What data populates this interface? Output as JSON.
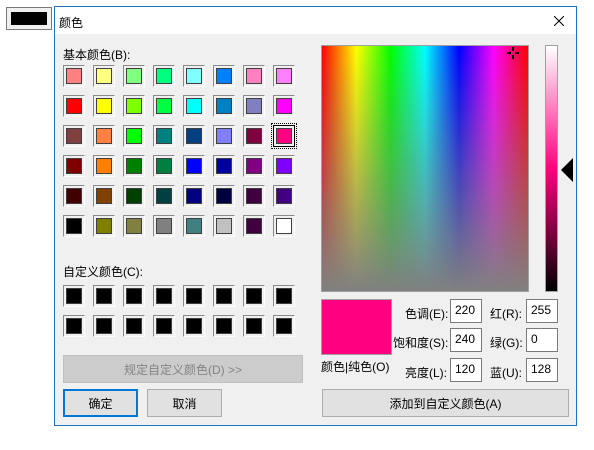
{
  "title": "颜色",
  "labels": {
    "basic_colors": "基本颜色(B):",
    "custom_colors": "自定义颜色(C):",
    "color_solid": "颜色|纯色(O)",
    "hue": "色调(E):",
    "sat": "饱和度(S):",
    "lum": "亮度(L):",
    "red": "红(R):",
    "green": "绿(G):",
    "blue": "蓝(U):"
  },
  "buttons": {
    "define_custom": "规定自定义颜色(D) >>",
    "ok": "确定",
    "cancel": "取消",
    "add_custom": "添加到自定义颜色(A)"
  },
  "values": {
    "hue": "220",
    "sat": "240",
    "lum": "120",
    "red": "255",
    "green": "0",
    "blue": "128"
  },
  "colors": {
    "selected": "#ff0080",
    "accent": "#0078d7"
  },
  "basic_colors": [
    "#ff8080",
    "#ffff80",
    "#80ff80",
    "#00ff80",
    "#80ffff",
    "#0080ff",
    "#ff80c0",
    "#ff80ff",
    "#ff0000",
    "#ffff00",
    "#80ff00",
    "#00ff40",
    "#00ffff",
    "#0080c0",
    "#8080c0",
    "#ff00ff",
    "#804040",
    "#ff8040",
    "#00ff00",
    "#008080",
    "#004080",
    "#8080ff",
    "#800040",
    "#ff0080",
    "#800000",
    "#ff8000",
    "#008000",
    "#008040",
    "#0000ff",
    "#0000a0",
    "#800080",
    "#8000ff",
    "#400000",
    "#804000",
    "#004000",
    "#004040",
    "#000080",
    "#000040",
    "#400040",
    "#400080",
    "#000000",
    "#808000",
    "#808040",
    "#808080",
    "#408080",
    "#c0c0c0",
    "#400040",
    "#ffffff"
  ],
  "selected_index": 23,
  "custom_colors": [
    "#000000",
    "#000000",
    "#000000",
    "#000000",
    "#000000",
    "#000000",
    "#000000",
    "#000000",
    "#000000",
    "#000000",
    "#000000",
    "#000000",
    "#000000",
    "#000000",
    "#000000",
    "#000000"
  ]
}
